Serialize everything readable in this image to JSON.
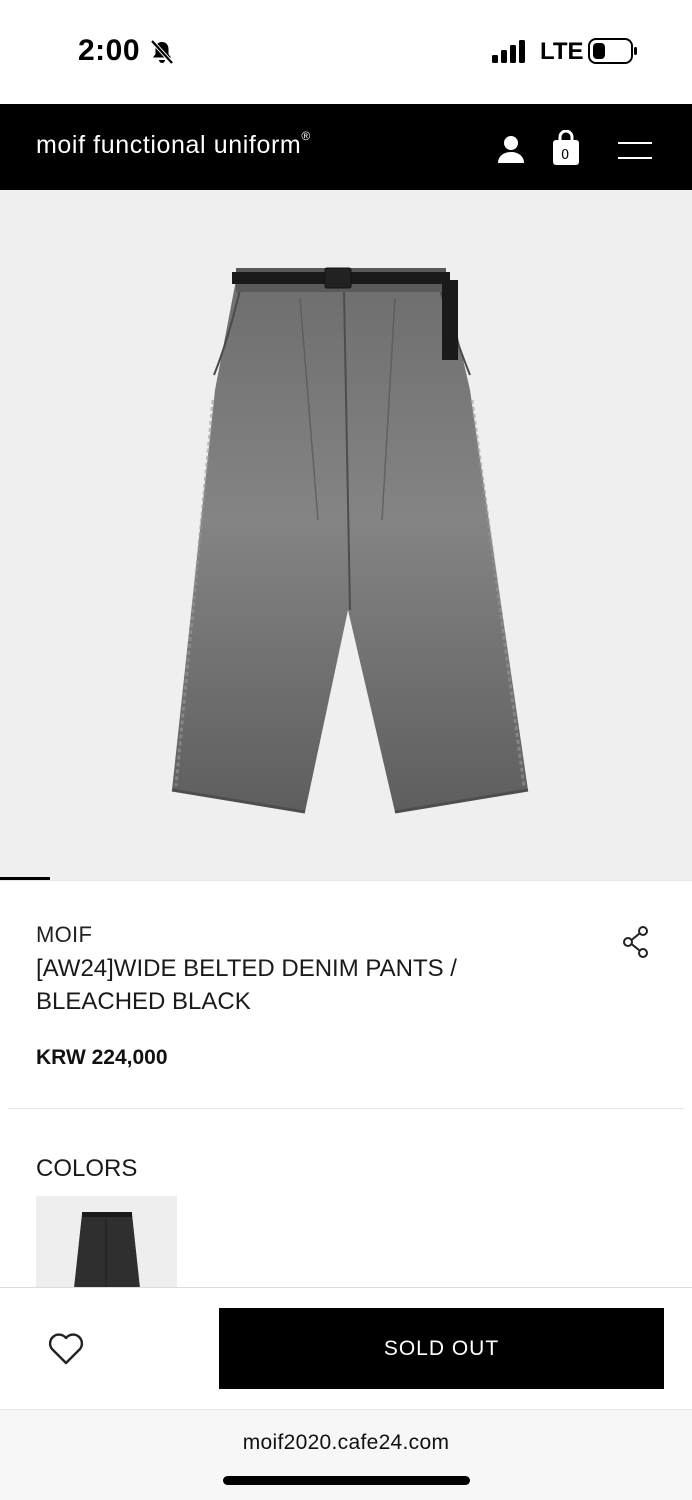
{
  "status_bar": {
    "time": "2:00",
    "network": "LTE"
  },
  "header": {
    "logo": "moif functional uniform",
    "logo_mark": "®",
    "cart_count": "0",
    "icons": [
      "user-icon",
      "bag-icon",
      "menu-icon"
    ]
  },
  "product": {
    "image_alt_icon": "denim-pants-image",
    "brand": "MOIF",
    "name_line1": "[AW24]WIDE BELTED DENIM PANTS /",
    "name_line2": "BLEACHED BLACK",
    "price": "KRW 224,000",
    "colors_label": "COLORS"
  },
  "actions": {
    "sold_out_label": "SOLD OUT"
  },
  "browser": {
    "url": "moif2020.cafe24.com"
  },
  "colors": {
    "header_bg": "#000000",
    "image_bg": "#efefef",
    "button_bg": "#000000"
  }
}
